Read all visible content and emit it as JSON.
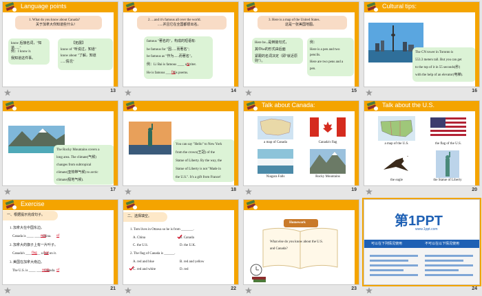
{
  "slides": [
    {
      "num": "13",
      "title": "Language points",
      "q": "1.   What do you know about Canada?",
      "q_cn": "关于加拿大你知道些什么?",
      "left": [
        "know 后接名词，\"知道......\"",
        "例：I know it.",
        "我知道这件事。"
      ],
      "right_title": "【拓展】",
      "right": [
        "know of \"听说过，知道\"",
        "know about \"了解，知道",
        "......情况\""
      ]
    },
    {
      "num": "14",
      "q": "2.  ...and it's famous all over the world.",
      "q_cn": "......并且它在全国都很出名。",
      "lines": [
        "famous \"著名的\"，构成的短语有:",
        "be famous for \"因......而著名\";",
        "be famous as \"作为......而著名\"。",
        "例：Li Bai is famous ____ a writer.",
        "He is famous ____ his poems."
      ],
      "ans1": "as",
      "ans2": "for"
    },
    {
      "num": "15",
      "q": "3. Here is a map of the United States.",
      "q_cn": "这是一张美国地图。",
      "left": [
        "Here be...是倒装句式，",
        "其中be的形式由后面",
        "紧跟的名词决定（即\"就近原则\"）。"
      ],
      "right": [
        "例：",
        "Here is a pen and two",
        "pencils.",
        "Here are two pens and a",
        "pen."
      ]
    },
    {
      "num": "16",
      "title": "Cultural tips:",
      "text": [
        "The CN tower in Toronto is",
        "553.3 meters tall. But you can get",
        "to the top of it in 55 seconds(秒)",
        "with the help of an elevator(电梯)."
      ]
    },
    {
      "num": "17",
      "text": [
        "The Rocky Mountains covers a",
        "long area. The climate(气候)",
        "changes from subtropical",
        "climate(亚热带气候) to arctic",
        "climate(极地气候)."
      ]
    },
    {
      "num": "18",
      "text": [
        "You can say \"Hello\" to New York",
        "from the crown(王冠) of the",
        "Statue of Liberty. By the way, the",
        "Statue of Liberty is not \"Made in",
        "the U.S.\". It's a gift from France!"
      ]
    },
    {
      "num": "19",
      "title": "Talk about Canada:",
      "captions": [
        "a map of Canada",
        "Canada's flag",
        "Niagara Falls",
        "Rocky Mountains"
      ]
    },
    {
      "num": "20",
      "title": "Talk about the U.S.",
      "captions": [
        "a map of the U.S.",
        "the flag of the U.S.",
        "the eagle",
        "the Statue of Liberty"
      ]
    },
    {
      "num": "21",
      "title": "Exercise",
      "sub": "一、根据提示完成句子。",
      "items": [
        "1. 加拿大在中国东边。",
        "Canada is ____ ____ China.",
        "2. 加拿大的旗子上有一片叶子。",
        "Canada's ____ ____ a leaf on it.",
        "3. 美国在加拿大南边。",
        "The U.S. is ____ ____ Canada."
      ],
      "ans": [
        "east",
        "of",
        "flag",
        "has",
        "south",
        "of"
      ]
    },
    {
      "num": "22",
      "sub": "二、选择填空。",
      "items": [
        "1. Tom lives in Ottawa so he is from _______.",
        "A. China",
        "B. Canada",
        "C. the U.S.",
        "D. the U.K.",
        "2. The flag of Canada is ______.",
        "A. red and blue",
        "B. red and yellow",
        "C. red and white",
        "D. red"
      ]
    },
    {
      "num": "23",
      "tag": "Homework",
      "question": [
        "What else do you know about the U.S.",
        "and Canada?"
      ]
    },
    {
      "num": "24",
      "brand": "第1PPT",
      "brand_sub": "www.1ppt.com",
      "left_head": "可以在下列情况使用",
      "right_head": "不可以在以下情况使用"
    }
  ],
  "colors": {
    "accent": "#f4a400",
    "red": "#d0021b",
    "peach": "#f8dcc6",
    "green": "#dcf3d6",
    "blue": "#1e60b4"
  }
}
